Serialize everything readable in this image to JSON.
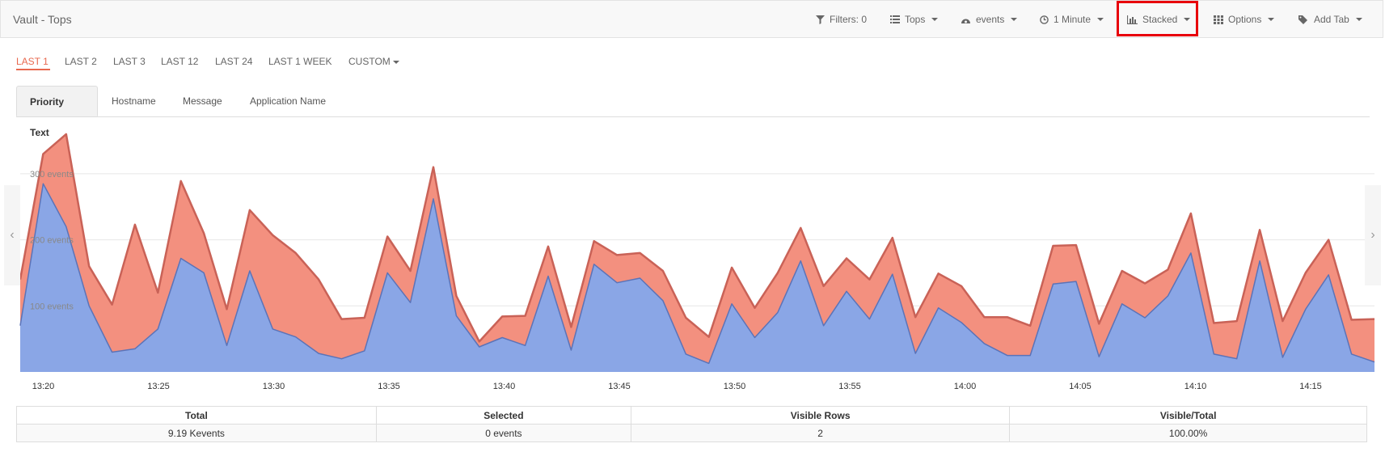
{
  "app": {
    "title": "Vault - Tops"
  },
  "toolbar": {
    "filters": "Filters: 0",
    "tops": "Tops",
    "events": "events",
    "interval": "1 Minute",
    "stacked": "Stacked",
    "options": "Options",
    "add_tab": "Add Tab"
  },
  "ranges": [
    "LAST 1",
    "LAST 2",
    "LAST 3",
    "LAST 12",
    "LAST 24",
    "LAST 1 WEEK",
    "CUSTOM"
  ],
  "active_range": "LAST 1",
  "panel_tabs": [
    "Priority Text",
    "Hostname",
    "Message",
    "Application Name"
  ],
  "active_panel_tab": "Priority Text",
  "chart_data": {
    "type": "area",
    "stacked": true,
    "y_ticks": [
      "100 events",
      "200 events",
      "300 events"
    ],
    "ylim": [
      0,
      365
    ],
    "x_ticks": [
      "13:20",
      "13:25",
      "13:30",
      "13:35",
      "13:40",
      "13:45",
      "13:50",
      "13:55",
      "14:00",
      "14:05",
      "14:10",
      "14:15"
    ],
    "x_start_minute": -1.0,
    "x_step_minutes": 1.0,
    "colors": {
      "bottom": "#8aa6e6",
      "top": "#f3907f",
      "line_bottom": "#5b73b8",
      "line_top": "#c96257"
    },
    "series": [
      {
        "values": [
          70,
          285,
          220,
          100,
          30,
          35,
          65,
          172,
          150,
          40,
          153,
          65,
          53,
          28,
          20,
          32,
          150,
          105,
          262,
          85,
          38,
          52,
          40,
          145,
          33,
          163,
          135,
          142,
          108,
          27,
          13,
          103,
          52,
          90,
          168,
          70,
          122,
          80,
          148,
          28,
          97,
          75,
          43,
          25,
          25,
          133,
          137,
          23,
          103,
          82,
          115,
          180,
          27,
          20,
          168,
          22,
          95,
          147,
          27,
          15
        ]
      },
      {
        "values": [
          70,
          45,
          140,
          60,
          72,
          188,
          55,
          117,
          60,
          55,
          92,
          142,
          127,
          112,
          60,
          50,
          55,
          48,
          48,
          30,
          8,
          32,
          45,
          45,
          35,
          35,
          42,
          38,
          45,
          55,
          40,
          55,
          45,
          60,
          50,
          60,
          50,
          60,
          55,
          55,
          52,
          55,
          40,
          58,
          45,
          58,
          55,
          50,
          50,
          52,
          40,
          60,
          47,
          57,
          47,
          55,
          55,
          53,
          52,
          65
        ]
      }
    ]
  },
  "stats": {
    "headers": [
      "Total",
      "Selected",
      "Visible Rows",
      "Visible/Total"
    ],
    "values": [
      "9.19 Kevents",
      "0 events",
      "2",
      "100.00%"
    ]
  }
}
